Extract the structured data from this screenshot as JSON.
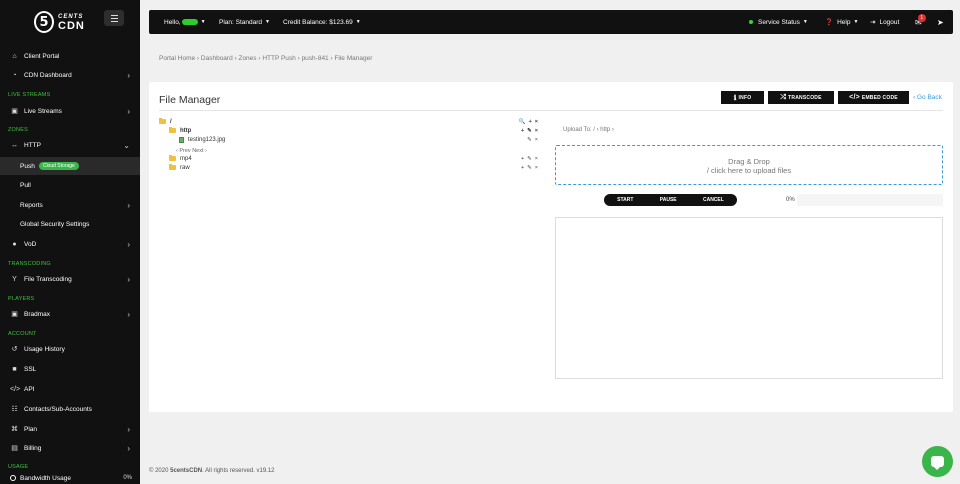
{
  "sidebar": {
    "logo_top": "CENTS",
    "logo_bottom": "CDN",
    "logo_mark": "5",
    "client_portal": "Client Portal",
    "cdn_dashboard": "CDN Dashboard",
    "sec_live": "LIVE STREAMS",
    "live_streams": "Live Streams",
    "sec_zones": "ZONES",
    "http": "HTTP",
    "push": "Push",
    "push_badge": "Cloud Storage",
    "pull": "Pull",
    "reports": "Reports",
    "global_security": "Global Security Settings",
    "vod": "VoD",
    "sec_transcoding": "TRANSCODING",
    "file_transcoding": "File Transcoding",
    "sec_players": "PLAYERS",
    "bradmax": "Bradmax",
    "sec_account": "ACCOUNT",
    "usage_history": "Usage History",
    "ssl": "SSL",
    "api": "API",
    "contacts": "Contacts/Sub-Accounts",
    "plan": "Plan",
    "billing": "Billing",
    "sec_usage": "USAGE",
    "bandwidth_usage": "Bandwidth Usage",
    "bandwidth_value": "0%"
  },
  "topbar": {
    "hello": "Hello,",
    "plan": "Plan: Standard",
    "credit": "Credit Balance: $123.69",
    "service_status": "Service Status",
    "help": "Help",
    "logout": "Logout",
    "mail_count": "1"
  },
  "breadcrumb": "Portal Home  ›  Dashboard  ›  Zones  ›  HTTP Push  ›  push-841  ›  File Manager",
  "file_manager": {
    "title": "File Manager",
    "btn_info": "INFO",
    "btn_transcode": "TRANSCODE",
    "btn_embed": "EMBED CODE",
    "go_back": "‹ Go Back",
    "tree": {
      "root": "/",
      "http": "http",
      "file": "testing123.jpg",
      "pager": "‹ Prev   Next ›",
      "mp4": "mp4",
      "raw": "raw"
    },
    "upload_to": "Upload To:  /  ›  http  ›",
    "drop_line1": "Drag & Drop",
    "drop_line2": "/ click here to upload files",
    "start": "START",
    "pause": "PAUSE",
    "cancel": "CANCEL",
    "progress": "0%"
  },
  "footer": {
    "prefix": "© 2020 ",
    "brand": "5centsCDN",
    "suffix": ". All rights reserved. v19.12"
  },
  "colors": {
    "accent_green": "#3ab54a",
    "link_blue": "#3a9bd9",
    "sidebar_bg": "#111111"
  }
}
